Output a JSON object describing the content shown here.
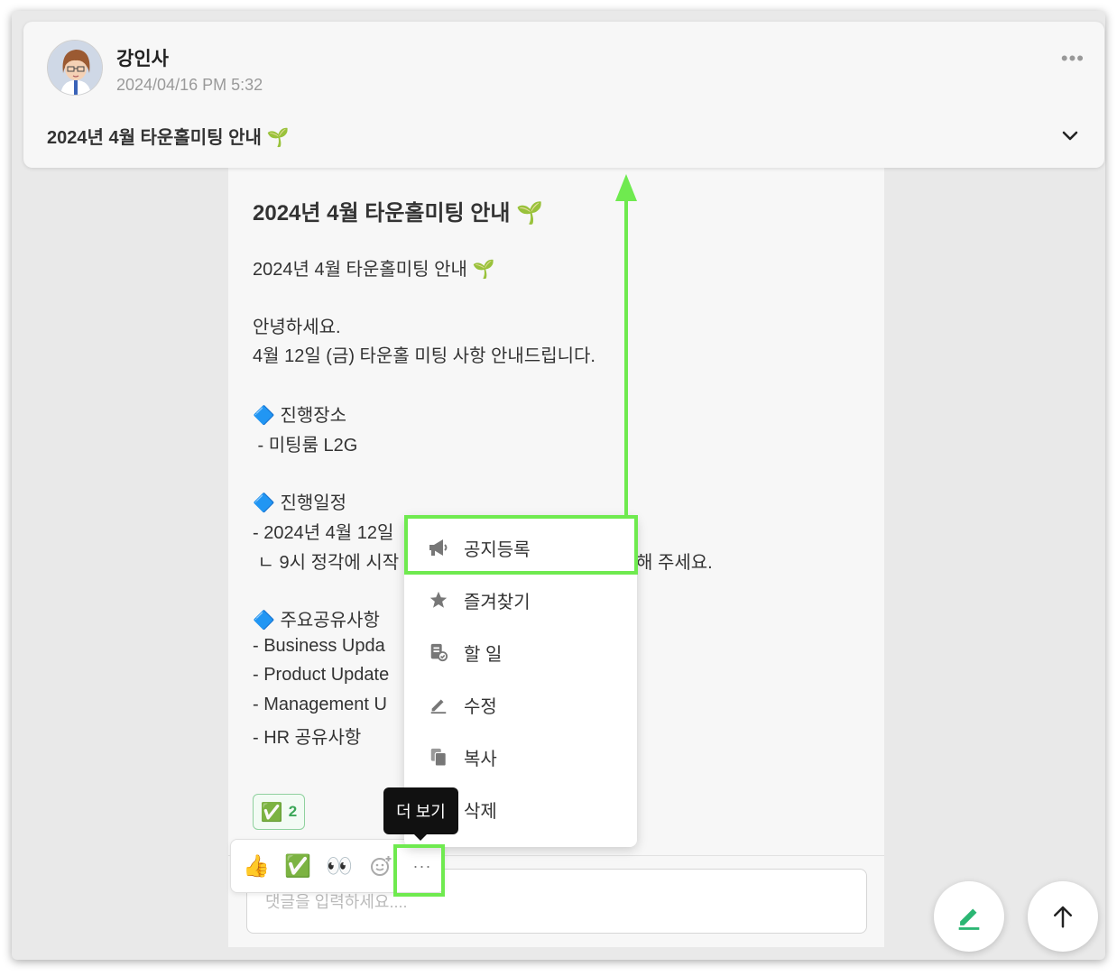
{
  "header": {
    "author": "강인사",
    "timestamp": "2024/04/16 PM 5:32",
    "title": "2024년 4월 타운홀미팅 안내 🌱"
  },
  "post": {
    "title": "2024년 4월 타운홀미팅 안내 🌱",
    "lines": [
      "2024년 4월 타운홀미팅 안내 🌱",
      "안녕하세요.",
      "4월 12일 (금) 타운홀 미팅 사항 안내드립니다.",
      "🔷 진행장소",
      " - 미팅룸 L2G",
      "🔷 진행일정",
      "- 2024년 4월 12일",
      " ㄴ 9시 정각에 시작",
      "해 주세요.",
      "🔷 주요공유사항",
      "- Business Upda",
      "- Product Update",
      "- Management U",
      "- HR 공유사항"
    ]
  },
  "reactions": {
    "chip_emoji": "✅",
    "chip_count": "2",
    "bar": [
      "👍",
      "✅",
      "👀"
    ],
    "add_icon": "add-emoji-icon",
    "more_label": "···"
  },
  "tooltip": "더 보기",
  "menu": {
    "items": [
      {
        "label": "공지등록",
        "icon": "megaphone-icon"
      },
      {
        "label": "즐겨찾기",
        "icon": "star-icon"
      },
      {
        "label": "할 일",
        "icon": "todo-icon"
      },
      {
        "label": "수정",
        "icon": "pencil-icon"
      },
      {
        "label": "복사",
        "icon": "copy-icon"
      },
      {
        "label": "삭제",
        "icon": "trash-icon"
      }
    ]
  },
  "comment": {
    "placeholder": "댓글을 입력하세요...."
  },
  "colors": {
    "highlight": "#6fea4f",
    "accent_green": "#3aa757"
  }
}
